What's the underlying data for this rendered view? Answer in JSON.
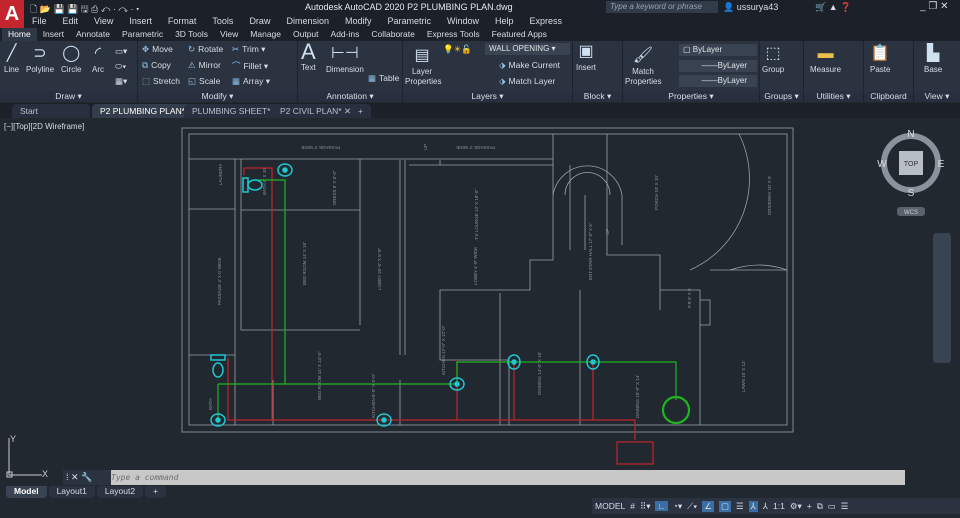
{
  "app": {
    "logo": "A",
    "title": "Autodesk AutoCAD 2020    P2 PLUMBING PLAN.dwg",
    "search_placeholder": "Type a keyword or phrase",
    "user": "ussurya43",
    "quick_access": "🗋 📂 💾 💾 🖫 ⎙ ↶ · ↷ · ▾"
  },
  "menu": [
    "File",
    "Edit",
    "View",
    "Insert",
    "Format",
    "Tools",
    "Draw",
    "Dimension",
    "Modify",
    "Parametric",
    "Window",
    "Help",
    "Express"
  ],
  "ribbon_tabs": [
    "Home",
    "Insert",
    "Annotate",
    "Parametric",
    "3D Tools",
    "View",
    "Manage",
    "Output",
    "Add-ins",
    "Collaborate",
    "Express Tools",
    "Featured Apps"
  ],
  "draw": {
    "title": "Draw",
    "line": "Line",
    "polyline": "Polyline",
    "circle": "Circle",
    "arc": "Arc"
  },
  "modify": {
    "title": "Modify",
    "move": "Move",
    "rotate": "Rotate",
    "trim": "Trim",
    "copy": "Copy",
    "mirror": "Mirror",
    "fillet": "Fillet",
    "stretch": "Stretch",
    "scale": "Scale",
    "array": "Array"
  },
  "annotation": {
    "title": "Annotation",
    "text": "Text",
    "dimension": "Dimension",
    "table": "Table"
  },
  "layers": {
    "title": "Layers",
    "layer_properties": "Layer Properties",
    "current_layer": "WALL OPENING",
    "make_current": "Make Current",
    "match_layer": "Match Layer"
  },
  "block": {
    "title": "Block",
    "insert": "Insert"
  },
  "properties": {
    "title": "Properties",
    "match_properties": "Match Properties",
    "color": "ByLayer",
    "linetype": "ByLayer",
    "lineweight": "ByLayer"
  },
  "groups": {
    "title": "Groups",
    "group": "Group"
  },
  "utilities": {
    "title": "Utilities",
    "measure": "Measure"
  },
  "clipboard": {
    "title": "Clipboard",
    "paste": "Paste"
  },
  "view": {
    "title": "View",
    "base": "Base"
  },
  "doc_tabs": [
    "Start",
    "P2 PLUMBING PLAN*",
    "PLUMBING SHEET*",
    "P2 CIVIL PLAN*"
  ],
  "viewport_label": "[−][Top][2D Wireframe]",
  "viewcube": {
    "n": "N",
    "s": "S",
    "e": "E",
    "w": "W",
    "top": "TOP",
    "wcs": "WCS"
  },
  "ucs": {
    "x": "X",
    "y": "Y"
  },
  "rooms": [
    "PASSAGE 3' WIDE",
    "LAUNDRY",
    "BATH 6' X 10'",
    "DRESS 6' X 6'-0\"",
    "BED ROOM 14' X 16'",
    "LOBBY 20'-0\" X 6'-0\"",
    "PASSAGE 4' X 0' WIDE",
    "BED ROOM 14' X 14'-0\"",
    "BATH",
    "KITCHEN 8'-0\" X 6'-0\"",
    "KITCHEN 12'-0\" X 12'-0\"",
    "T.V LOUNGE 13' X 18'-0\"",
    "LOBBY 4'-0\" WIDE",
    "ENT.STAIR HALL 17'-0\" X 8'",
    "UP",
    "PORCH 10' X 10'",
    "DRIVEWAY 10' X 0'",
    "P.R 6' X 6'",
    "DINNING 14'-0\" X 10'",
    "DINNING 10'-0\" X 14'",
    "LAWN 10' X 12'",
    "PASSAGE 3' WIDE",
    "UP"
  ],
  "command": {
    "placeholder": "Type a command"
  },
  "layout_tabs": [
    "Model",
    "Layout1",
    "Layout2",
    "+"
  ],
  "status": {
    "model": "MODEL",
    "scale": "1:1"
  },
  "colors": {
    "accent": "#3a6ea5",
    "pipe_red": "#c0262d",
    "pipe_green": "#1fb51f",
    "fixture": "#1fc8d0"
  }
}
